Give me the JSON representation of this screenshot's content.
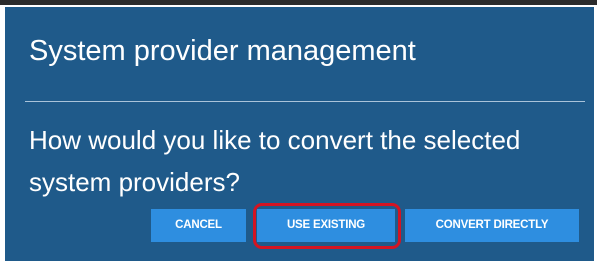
{
  "dialog": {
    "title": "System provider management",
    "question": "How would you like to convert the selected system providers?",
    "buttons": {
      "cancel": "CANCEL",
      "use_existing": "USE EXISTING",
      "convert_directly": "CONVERT DIRECTLY"
    }
  },
  "colors": {
    "dialog_background": "#1f5a8a",
    "button_background": "#2e8ee0",
    "highlight": "#d41422"
  }
}
